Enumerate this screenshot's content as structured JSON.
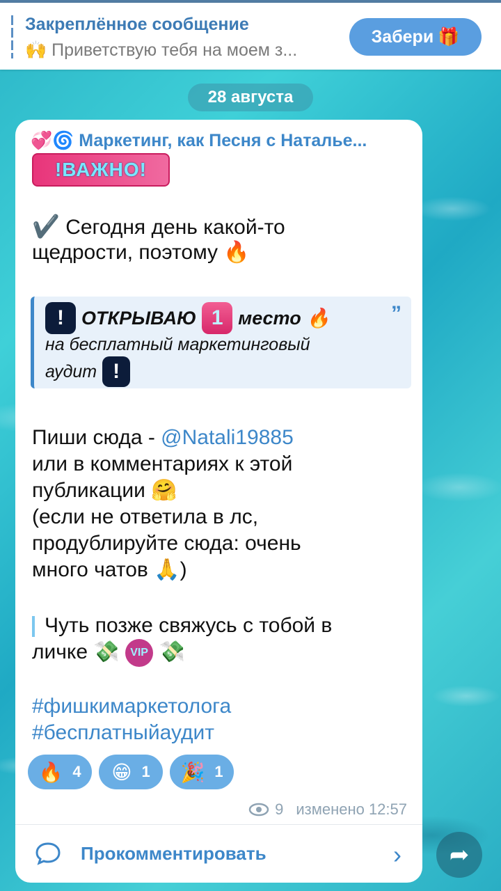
{
  "pinned": {
    "title": "Закреплённое сообщение",
    "emoji": "🙌",
    "text": "Приветствую тебя на моем з...",
    "button_label": "Забери",
    "button_emoji": "🎁"
  },
  "date_label": "28 августа",
  "post": {
    "channel_emoji": "💞🌀",
    "channel_name": "Маркетинг, как Песня с Натальe...",
    "badge": "!ВАЖНО!",
    "line1_emoji": "✔️",
    "line1": "Сегодня день какой-то",
    "line2": "щедрости, поэтому",
    "line2_emoji": "🔥",
    "quote": {
      "exclaim": "!",
      "word1": "ОТКРЫВАЮ",
      "one": "1",
      "word2": "место",
      "fire": "🔥",
      "line2": "на бесплатный маркетинговый",
      "line3": "аудит"
    },
    "write_prefix": "Пиши сюда - ",
    "write_link": "@Natali19885",
    "write_line2": "или в комментариях к этой",
    "write_line3": "публикации",
    "hug_emoji": "🤗",
    "note_line1": "(если не ответила в лс,",
    "note_line2": "продублируйте сюда: очень",
    "note_line3": "много чатов",
    "pray_emoji": "🙏",
    "note_close": ")",
    "later_line1": "Чуть позже свяжусь с тобой в",
    "later_line2": "личке",
    "later_emojis": "💸",
    "vip": "VIP",
    "hashtag1": "#фишкимаркетолога",
    "hashtag2": "#бесплатныйаудит",
    "reactions": [
      {
        "emoji": "🔥",
        "count": "4"
      },
      {
        "emoji": "😁",
        "count": "1"
      },
      {
        "emoji": "🎉",
        "count": "1"
      }
    ],
    "views": "9",
    "edited_label": "изменено 12:57",
    "comment_label": "Прокомментировать"
  },
  "colors": {
    "accent": "#3d87c9",
    "reaction_bg": "#6aaee5",
    "pin_button": "#5a9ee0"
  }
}
